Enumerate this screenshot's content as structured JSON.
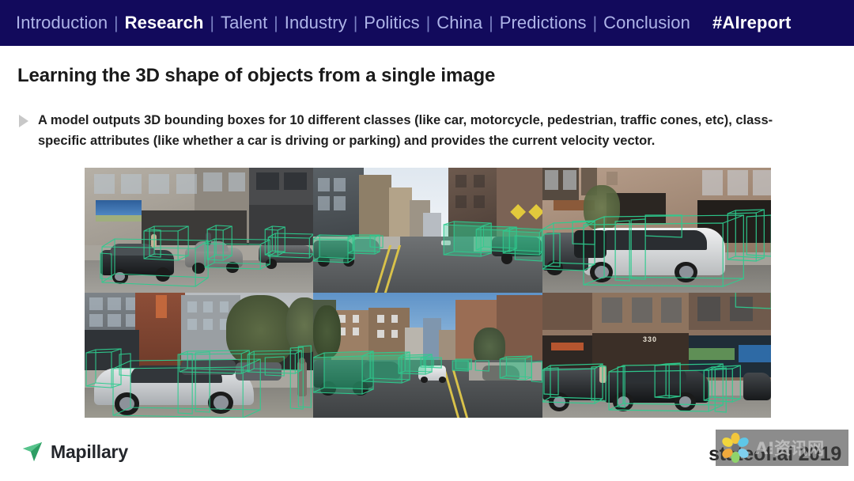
{
  "nav": {
    "items": [
      {
        "label": "Introduction",
        "active": false
      },
      {
        "label": "Research",
        "active": true
      },
      {
        "label": "Talent",
        "active": false
      },
      {
        "label": "Industry",
        "active": false
      },
      {
        "label": "Politics",
        "active": false
      },
      {
        "label": "China",
        "active": false
      },
      {
        "label": "Predictions",
        "active": false
      },
      {
        "label": "Conclusion",
        "active": false
      }
    ],
    "separator": "|",
    "hashtag": "#AIreport",
    "background_color": "#120a5c",
    "link_color": "#aeb4e8",
    "active_color": "#ffffff"
  },
  "headline": "Learning the 3D shape of objects from a single image",
  "bullet": {
    "marker": "triangle-right-icon",
    "text": "A model outputs 3D bounding boxes for 10 different classes (like car, motorcycle, pedestrian, traffic cones, etc), class-specific attributes (like whether a car is driving or parking) and provides the current velocity vector."
  },
  "figure": {
    "caption": "",
    "box_color": "#2ecc8f",
    "panels": [
      {
        "id": "panel-1",
        "description": "Parked cars along city street with 3D bounding boxes"
      },
      {
        "id": "panel-2",
        "description": "Street view down avenue with yellow center lines and boxed vehicles"
      },
      {
        "id": "panel-3",
        "description": "Silver minivan parked at curb with 3D bounding box"
      },
      {
        "id": "panel-4",
        "description": "Silver sedan parked in front of brick building with pedestrian"
      },
      {
        "id": "panel-5",
        "description": "Wide city avenue with oncoming traffic and boxed parked cars"
      },
      {
        "id": "panel-6",
        "description": "Dark sedans parked in front of storefront numbered 330",
        "building_number": "330"
      }
    ]
  },
  "footer": {
    "logo_mark": "mapillary-arrow-icon",
    "logo_text": "Mapillary",
    "report_label": "stateof.ai 2019"
  },
  "watermark": {
    "logo": "flower-image-viewer-icon",
    "text": "AI资讯网"
  }
}
